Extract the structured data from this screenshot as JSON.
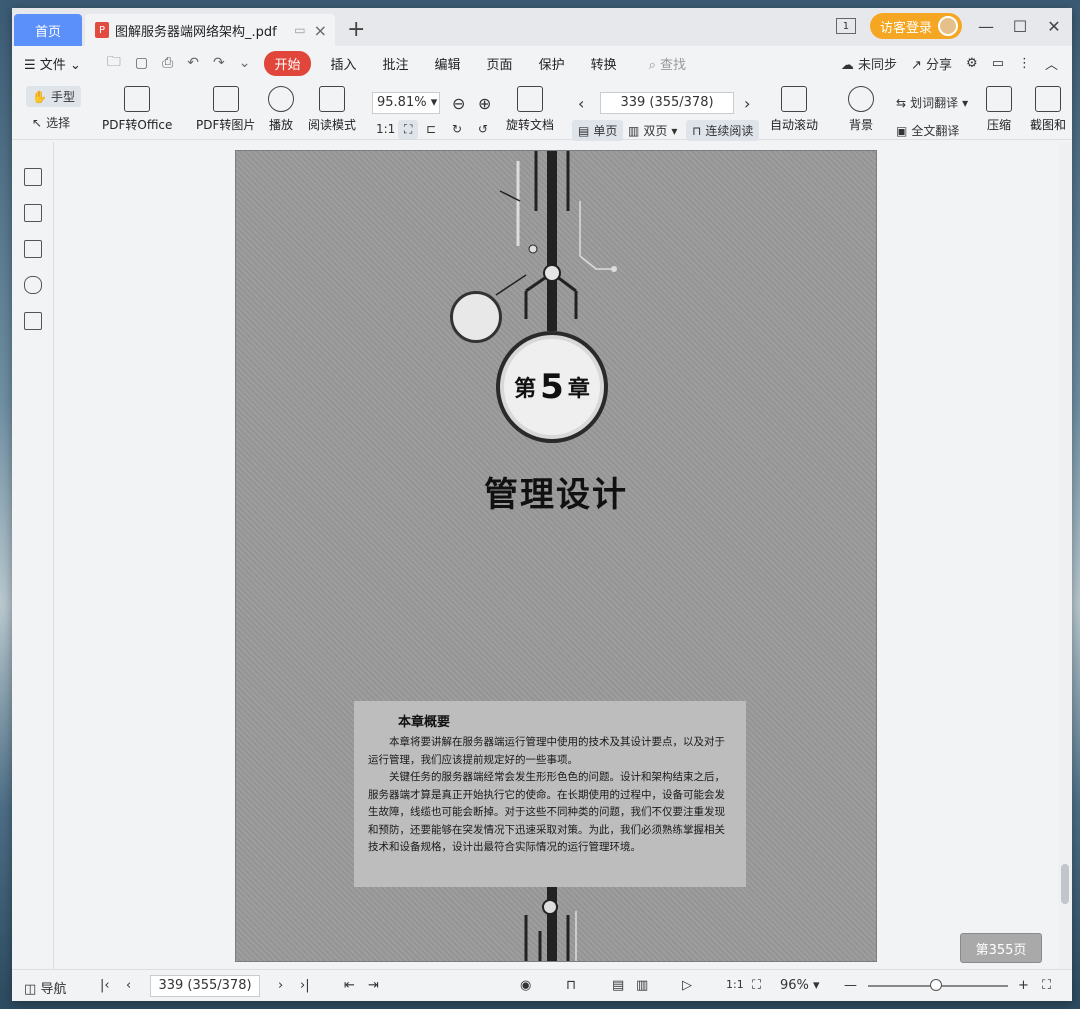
{
  "titlebar": {
    "home_tab": "首页",
    "doc_tab": "图解服务器端网络架构_.pdf",
    "guest_login": "访客登录"
  },
  "menu": {
    "file": "文件",
    "tabs": [
      "开始",
      "插入",
      "批注",
      "编辑",
      "页面",
      "保护",
      "转换"
    ],
    "search_placeholder": "查找",
    "unsync": "未同步",
    "share": "分享"
  },
  "ribbon": {
    "hand": "手型",
    "select": "选择",
    "pdf_to_office": "PDF转Office",
    "pdf_to_image": "PDF转图片",
    "play": "播放",
    "read_mode": "阅读模式",
    "zoom": "95.81%",
    "rotate_doc": "旋转文档",
    "page_input": "339 (355/378)",
    "single_page": "单页",
    "double_page": "双页",
    "continuous": "连续阅读",
    "auto_scroll": "自动滚动",
    "background": "背景",
    "word_translate": "划词翻译",
    "full_translate": "全文翻译",
    "compress": "压缩",
    "screenshot": "截图和"
  },
  "document": {
    "chapter_prefix": "第",
    "chapter_number": "5",
    "chapter_suffix": "章",
    "chapter_title": "管理设计",
    "summary_title": "本章概要",
    "summary_p1": "本章将要讲解在服务器端运行管理中使用的技术及其设计要点，以及对于运行管理，我们应该提前规定好的一些事项。",
    "summary_p2": "关键任务的服务器端经常会发生形形色色的问题。设计和架构结束之后，服务器端才算是真正开始执行它的使命。在长期使用的过程中，设备可能会发生故障，线缆也可能会断掉。对于这些不同种类的问题，我们不仅要注重发现和预防，还要能够在突发情况下迅速采取对策。为此，我们必须熟练掌握相关技术和设备规格，设计出最符合实际情况的运行管理环境。",
    "page_badge": "第355页"
  },
  "status": {
    "nav": "导航",
    "page_input": "339 (355/378)",
    "zoom": "96%"
  }
}
